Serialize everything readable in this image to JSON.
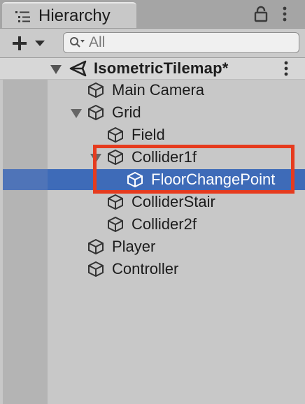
{
  "panel": {
    "title": "Hierarchy",
    "icons": {
      "tab": "hierarchy-list-icon",
      "lock": "lock-icon",
      "menu": "kebab-menu-icon"
    }
  },
  "toolbar": {
    "add_icon": "plus-dropdown-icon",
    "search_placeholder": "All",
    "search_value": ""
  },
  "scene": {
    "name": "IsometricTilemap*",
    "icon": "unity-scene-icon",
    "expanded": true
  },
  "items": [
    {
      "label": "Main Camera",
      "depth": 0,
      "icon": "gameobject-cube-icon",
      "expanded": null,
      "selected": false
    },
    {
      "label": "Grid",
      "depth": 0,
      "icon": "gameobject-cube-icon",
      "expanded": true,
      "selected": false
    },
    {
      "label": "Field",
      "depth": 1,
      "icon": "gameobject-cube-icon",
      "expanded": null,
      "selected": false
    },
    {
      "label": "Collider1f",
      "depth": 1,
      "icon": "gameobject-cube-icon",
      "expanded": true,
      "selected": false
    },
    {
      "label": "FloorChangePoint",
      "depth": 2,
      "icon": "gameobject-cube-icon",
      "expanded": null,
      "selected": true
    },
    {
      "label": "ColliderStair",
      "depth": 1,
      "icon": "gameobject-cube-icon",
      "expanded": null,
      "selected": false
    },
    {
      "label": "Collider2f",
      "depth": 1,
      "icon": "gameobject-cube-icon",
      "expanded": null,
      "selected": false
    },
    {
      "label": "Player",
      "depth": 0,
      "icon": "gameobject-cube-icon",
      "expanded": null,
      "selected": false
    },
    {
      "label": "Controller",
      "depth": 0,
      "icon": "gameobject-cube-icon",
      "expanded": null,
      "selected": false
    }
  ],
  "colors": {
    "selection": "#3e6bb8",
    "annotation": "#e63b1e",
    "panel_bg": "#c8c8c8"
  }
}
